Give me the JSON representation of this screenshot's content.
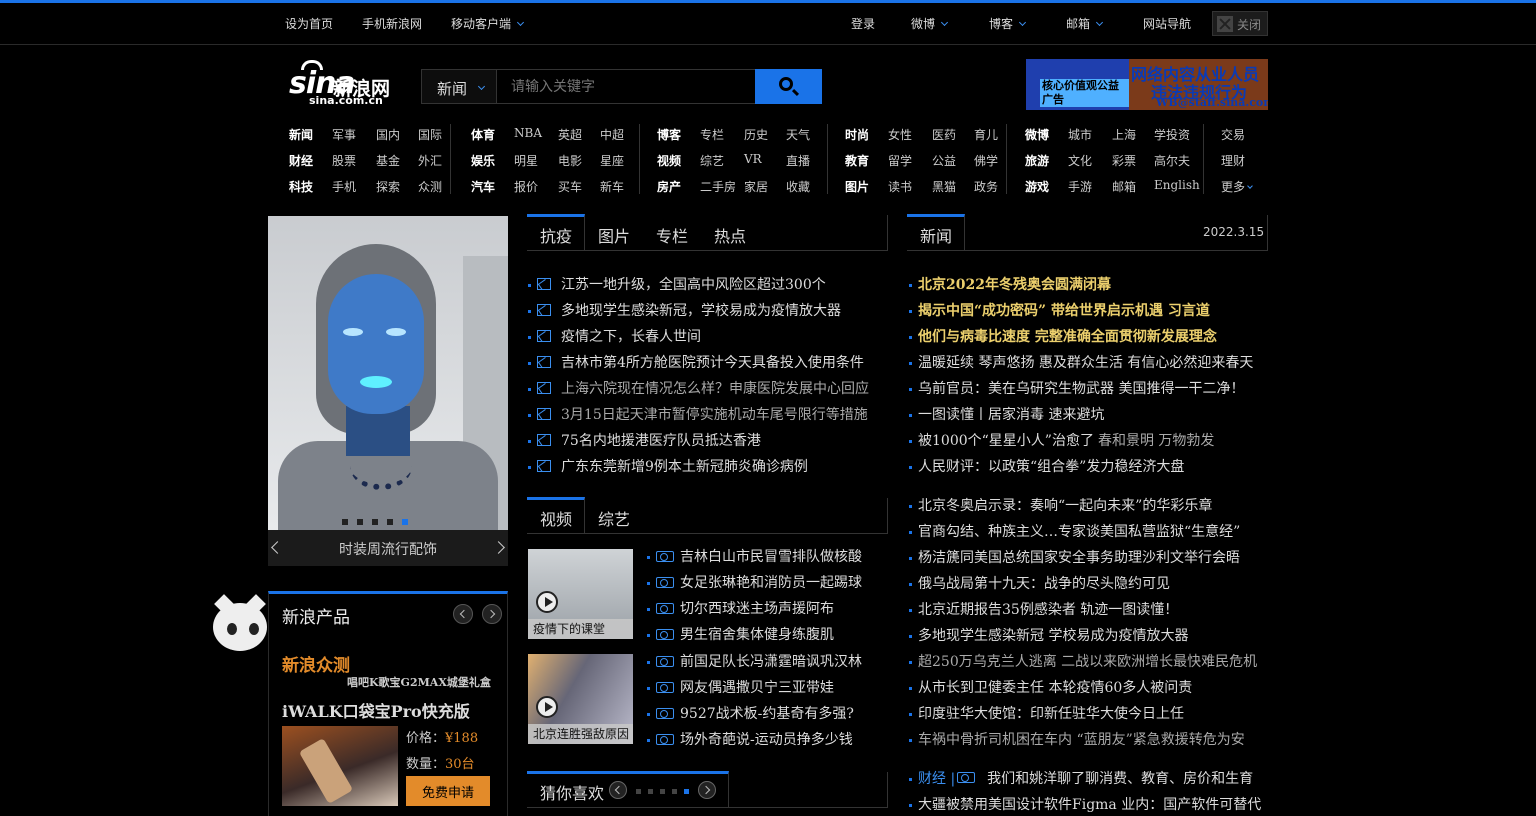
{
  "topbar": {
    "set_home": "设为首页",
    "mobile_sina": "手机新浪网",
    "mobile_client": "移动客户端",
    "login": "登录",
    "weibo": "微博",
    "blog": "博客",
    "mail": "邮箱",
    "site_nav": "网站导航",
    "close": "关闭"
  },
  "logo": {
    "brand": "sina",
    "cn": "新浪网",
    "domain": "sina.com.cn"
  },
  "search": {
    "category": "新闻",
    "placeholder": "请输入关键字"
  },
  "ad": {
    "left": "核心价值观公益广告",
    "line1": "网络内容从业人员",
    "line2": "违法违规行为",
    "line3": "WB@staff.sina.com"
  },
  "nav": {
    "g1": [
      [
        "新闻",
        "军事",
        "国内",
        "国际"
      ],
      [
        "财经",
        "股票",
        "基金",
        "外汇"
      ],
      [
        "科技",
        "手机",
        "探索",
        "众测"
      ]
    ],
    "g2": [
      [
        "体育",
        "NBA",
        "英超",
        "中超"
      ],
      [
        "娱乐",
        "明星",
        "电影",
        "星座"
      ],
      [
        "汽车",
        "报价",
        "买车",
        "新车"
      ]
    ],
    "g3": [
      [
        "博客",
        "专栏",
        "历史",
        "天气"
      ],
      [
        "视频",
        "综艺",
        "VR",
        "直播"
      ],
      [
        "房产",
        "二手房",
        "家居",
        "收藏"
      ]
    ],
    "g4": [
      [
        "时尚",
        "女性",
        "医药",
        "育儿"
      ],
      [
        "教育",
        "留学",
        "公益",
        "佛学"
      ],
      [
        "图片",
        "读书",
        "黑猫",
        "政务"
      ]
    ],
    "g5": [
      [
        "微博",
        "城市",
        "上海",
        "学投资"
      ],
      [
        "旅游",
        "文化",
        "彩票",
        "高尔夫"
      ],
      [
        "游戏",
        "手游",
        "邮箱",
        "English"
      ]
    ],
    "g6": [
      "交易",
      "理财",
      "更多"
    ]
  },
  "slideshow": {
    "caption": "时装周流行配饰"
  },
  "products": {
    "title": "新浪产品",
    "brand": "新浪众测",
    "slogan": "唱吧K歌宝G2MAX城堡礼盒",
    "product": "iWALK口袋宝Pro快充版",
    "price_label": "价格：",
    "price": "¥188",
    "qty_label": "数量：",
    "qty": "30台",
    "apply": "免费申请"
  },
  "epidemic": {
    "tabs": [
      "抗疫",
      "图片",
      "专栏",
      "热点"
    ],
    "items": [
      "江苏一地升级，全国高中风险区超过300个",
      "多地现学生感染新冠，学校易成为疫情放大器",
      "疫情之下，长春人世间",
      "吉林市第4所方舱医院预计今天具备投入使用条件",
      "上海六院现在情况怎么样？申康医院发展中心回应",
      "3月15日起天津市暂停实施机动车尾号限行等措施",
      "75名内地援港医疗队员抵达香港",
      "广东东莞新增9例本土新冠肺炎确诊病例"
    ]
  },
  "video": {
    "tabs": [
      "视频",
      "综艺"
    ],
    "thumb1": "疫情下的课堂",
    "thumb2": "北京连胜强敌原因",
    "items": [
      "吉林白山市民冒雪排队做核酸",
      "女足张琳艳和消防员一起踢球",
      "切尔西球迷主场声援阿布",
      "男生宿舍集体健身练腹肌",
      "前国足队长冯潇霆暗讽巩汉林",
      "网友偶遇撒贝宁三亚带娃",
      "9527战术板-约基奇有多强?",
      "场外奇葩说-运动员挣多少钱"
    ]
  },
  "guess": {
    "title": "猜你喜欢"
  },
  "news": {
    "tab": "新闻",
    "date": "2022.3.15",
    "bold": [
      "北京2022年冬残奥会圆满闭幕",
      "揭示中国“成功密码” 带给世界启示机遇 习言道",
      "他们与病毒比速度 完整准确全面贯彻新发展理念"
    ],
    "items1": [
      "温暖延续 琴声悠扬 惠及群众生活 有信心必然迎来春天",
      "乌前官员：美在乌研究生物武器 美国推得一干二净！",
      "一图读懂丨居家消毒 速来避坑"
    ],
    "item_split_a": "被1000个“星星小人”治愈了",
    "item_split_b": "春和景明 万物勃发",
    "item_last": "人民财评：以政策“组合拳”发力稳经济大盘",
    "items2": [
      "北京冬奥启示录：奏响“一起向未来”的华彩乐章",
      "官商勾结、种族主义…专家谈美国私营监狱“生意经”",
      "杨洁篪同美国总统国家安全事务助理沙利文举行会晤",
      "俄乌战局第十九天：战争的尽头隐约可见",
      "北京近期报告35例感染者 轨迹一图读懂！",
      "多地现学生感染新冠 学校易成为疫情放大器",
      "超250万乌克兰人逃离 二战以来欧洲增长最快难民危机",
      "从市长到卫健委主任 本轮疫情60多人被问责",
      "印度驻华大使馆：印新任驻华大使今日上任",
      "车祸中骨折司机困在车内 “蓝朋友”紧急救援转危为安"
    ],
    "finance_tag": "财经 |",
    "finance_item": "我们和姚洋聊了聊消费、教育、房价和生育",
    "last_item": "大疆被禁用美国设计软件Figma 业内：国产软件可替代"
  }
}
